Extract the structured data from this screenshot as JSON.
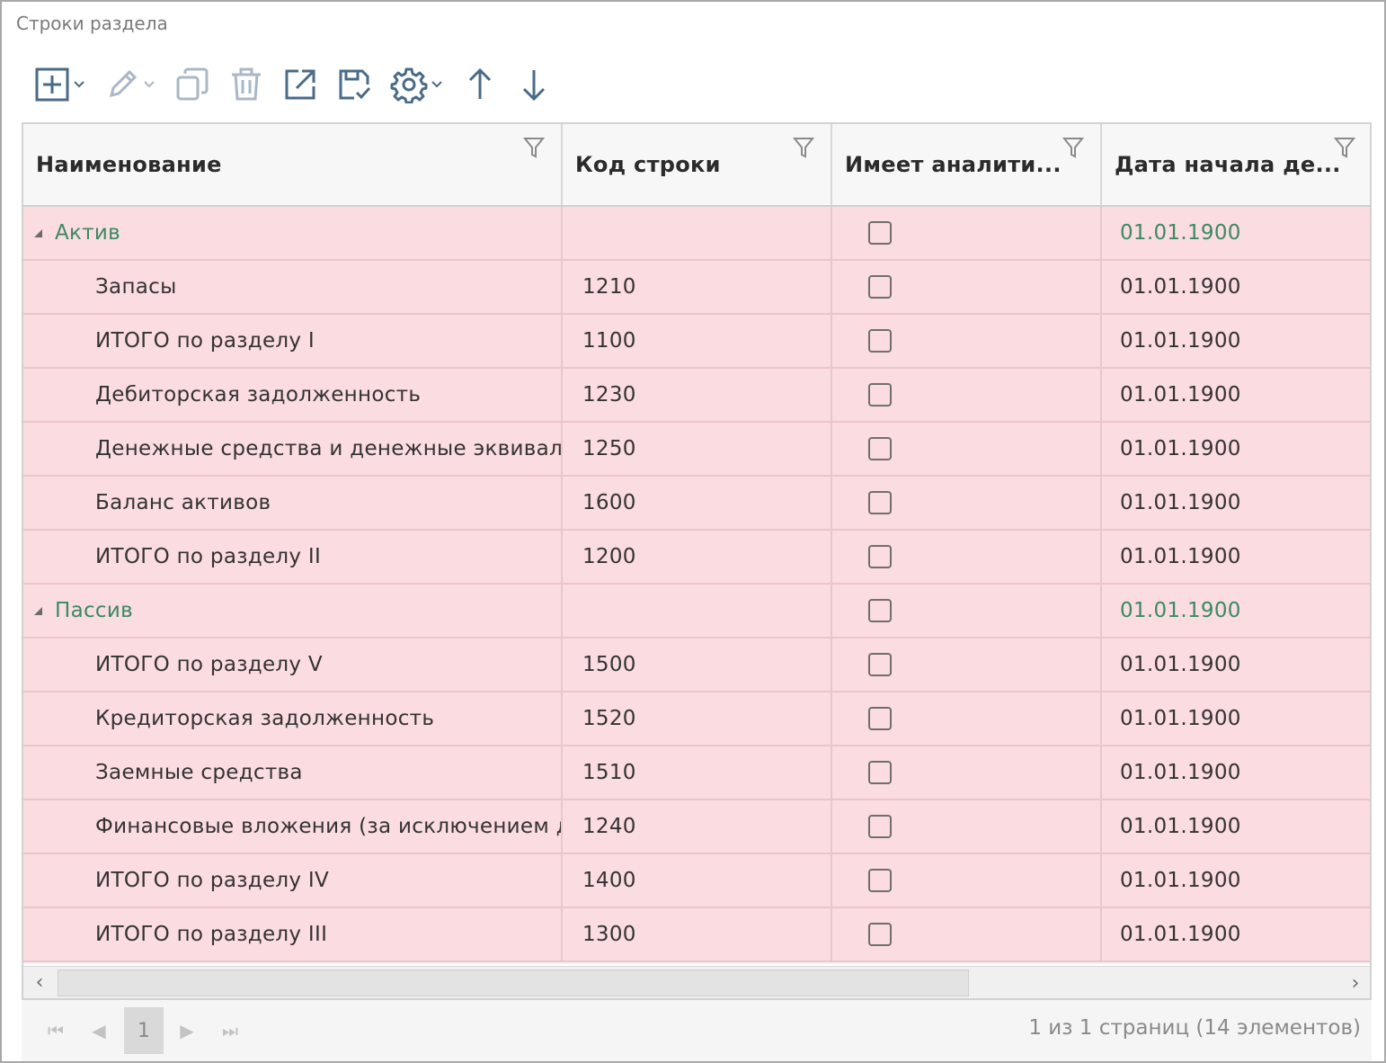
{
  "panel": {
    "title": "Строки раздела"
  },
  "toolbar": {
    "items": [
      {
        "icon": "add-icon",
        "has_dropdown": true
      },
      {
        "icon": "edit-icon",
        "has_dropdown": true
      },
      {
        "icon": "copy-icon"
      },
      {
        "icon": "delete-icon"
      },
      {
        "icon": "open-external-icon"
      },
      {
        "icon": "save-check-icon"
      },
      {
        "icon": "gear-icon",
        "has_dropdown": true
      },
      {
        "icon": "arrow-up-icon"
      },
      {
        "icon": "arrow-down-icon"
      }
    ]
  },
  "grid": {
    "columns": [
      "Наименование",
      "Код строки",
      "Имеет аналити...",
      "Дата начала де..."
    ],
    "rows": [
      {
        "group": true,
        "name": "Актив",
        "code": "",
        "checked": false,
        "date": "01.01.1900"
      },
      {
        "group": false,
        "name": "Запасы",
        "code": "1210",
        "checked": false,
        "date": "01.01.1900"
      },
      {
        "group": false,
        "name": "ИТОГО по разделу I",
        "code": "1100",
        "checked": false,
        "date": "01.01.1900"
      },
      {
        "group": false,
        "name": "Дебиторская задолженность",
        "code": "1230",
        "checked": false,
        "date": "01.01.1900"
      },
      {
        "group": false,
        "name": "Денежные средства и денежные эквивален",
        "code": "1250",
        "checked": false,
        "date": "01.01.1900"
      },
      {
        "group": false,
        "name": "Баланс активов",
        "code": "1600",
        "checked": false,
        "date": "01.01.1900"
      },
      {
        "group": false,
        "name": "ИТОГО по разделу II",
        "code": "1200",
        "checked": false,
        "date": "01.01.1900"
      },
      {
        "group": true,
        "name": "Пассив",
        "code": "",
        "checked": false,
        "date": "01.01.1900"
      },
      {
        "group": false,
        "name": "ИТОГО по разделу V",
        "code": "1500",
        "checked": false,
        "date": "01.01.1900"
      },
      {
        "group": false,
        "name": "Кредиторская задолженность",
        "code": "1520",
        "checked": false,
        "date": "01.01.1900"
      },
      {
        "group": false,
        "name": "Заемные средства",
        "code": "1510",
        "checked": false,
        "date": "01.01.1900"
      },
      {
        "group": false,
        "name": "Финансовые вложения (за исключением де",
        "code": "1240",
        "checked": false,
        "date": "01.01.1900"
      },
      {
        "group": false,
        "name": "ИТОГО по разделу IV",
        "code": "1400",
        "checked": false,
        "date": "01.01.1900"
      },
      {
        "group": false,
        "name": "ИТОГО по разделу III",
        "code": "1300",
        "checked": false,
        "date": "01.01.1900"
      }
    ]
  },
  "scrollbar": {
    "left_arrow": "‹",
    "right_arrow": "›"
  },
  "pager": {
    "first": "⏮",
    "prev": "◀",
    "current_page": "1",
    "next": "▶",
    "last": "⏭",
    "info": "1 из 1 страниц (14 элементов)"
  },
  "colors": {
    "row_bg": "#fbdce0",
    "group_text": "#3a8a62",
    "accent_icon": "#4a6b88"
  }
}
